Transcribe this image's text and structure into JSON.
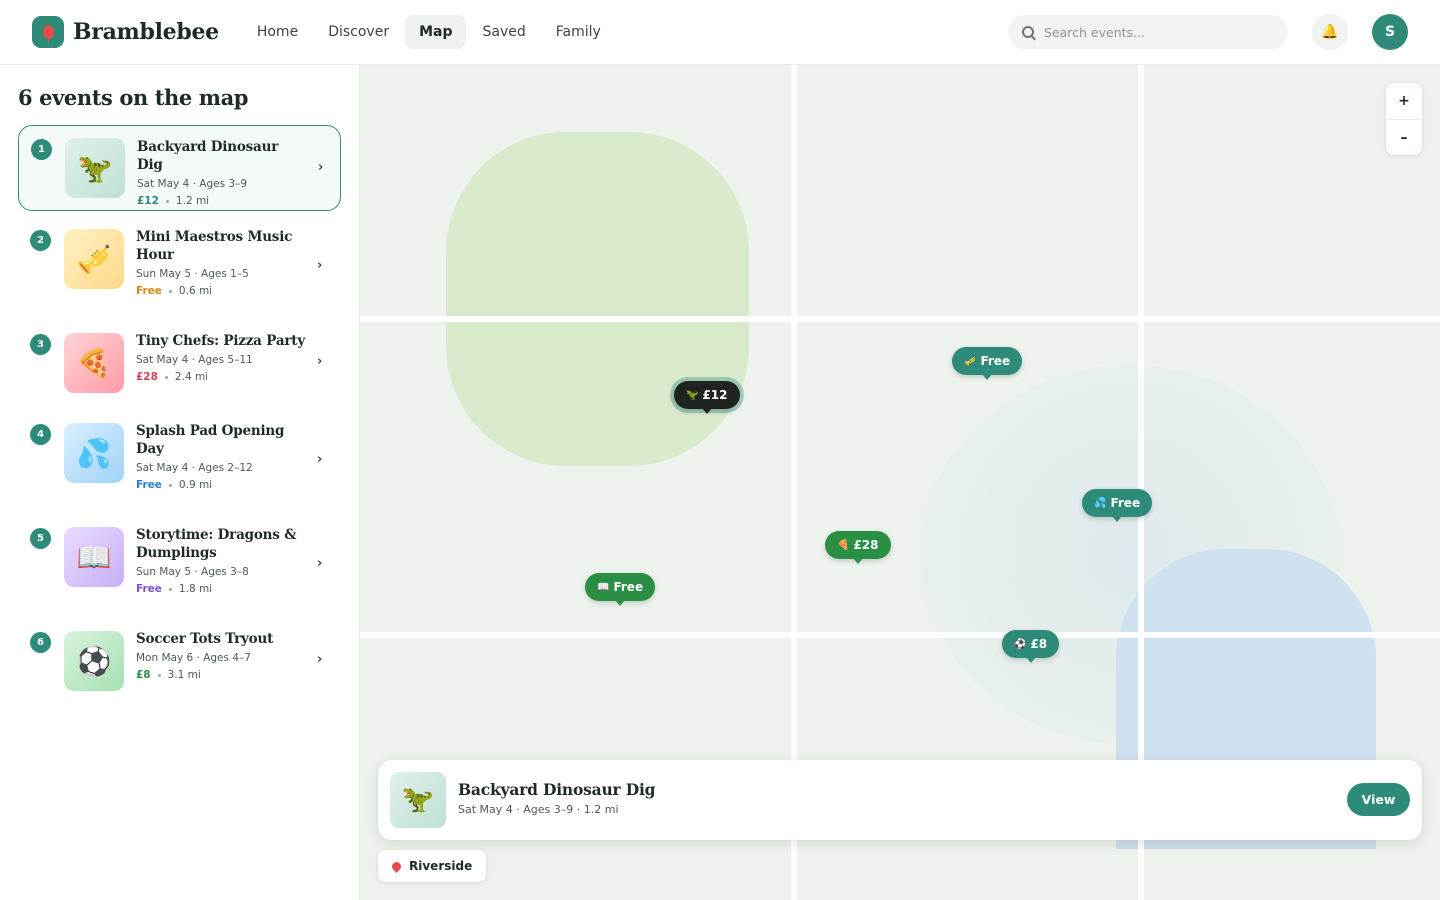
{
  "app": {
    "name": "Bramblebee"
  },
  "nav": {
    "items": [
      {
        "label": "Home"
      },
      {
        "label": "Discover"
      },
      {
        "label": "Map"
      },
      {
        "label": "Saved"
      },
      {
        "label": "Family"
      }
    ],
    "active": "Map"
  },
  "search": {
    "placeholder": "Search events..."
  },
  "user": {
    "initial": "S"
  },
  "sidebar": {
    "title": "6 events on the map",
    "events": [
      {
        "num": "1",
        "title": "Backyard Dinosaur Dig",
        "meta": "Sat May 4 · Ages 3–9",
        "price": "£12",
        "price_color": "#2e8b7a",
        "distance": "1.2 mi",
        "icon": "dinosaur",
        "glyph": "🦖",
        "thumb_bg": "linear-gradient(135deg,#dff0ea,#bfe0d6)"
      },
      {
        "num": "2",
        "title": "Mini Maestros Music Hour",
        "meta": "Sun May 5 · Ages 1–5",
        "price": "Free",
        "price_color": "#d68a10",
        "distance": "0.6 mi",
        "icon": "trumpet",
        "glyph": "🎺",
        "thumb_bg": "linear-gradient(135deg,#fff1c2,#ffd88a)"
      },
      {
        "num": "3",
        "title": "Tiny Chefs: Pizza Party",
        "meta": "Sat May 4 · Ages 5–11",
        "price": "£28",
        "price_color": "#d0455a",
        "distance": "2.4 mi",
        "icon": "pizza",
        "glyph": "🍕",
        "thumb_bg": "linear-gradient(135deg,#ffd4d8,#ff9aa6)"
      },
      {
        "num": "4",
        "title": "Splash Pad Opening Day",
        "meta": "Sat May 4 · Ages 2–12",
        "price": "Free",
        "price_color": "#2f7fd0",
        "distance": "0.9 mi",
        "icon": "droplets",
        "glyph": "💦",
        "thumb_bg": "linear-gradient(135deg,#d9efff,#9fd3f7)"
      },
      {
        "num": "5",
        "title": "Storytime: Dragons & Dumplings",
        "meta": "Sun May 5 · Ages 3–8",
        "price": "Free",
        "price_color": "#7a4fd0",
        "distance": "1.8 mi",
        "icon": "open-book",
        "glyph": "📖",
        "thumb_bg": "linear-gradient(135deg,#e9dcff,#c6aef5)"
      },
      {
        "num": "6",
        "title": "Soccer Tots Tryout",
        "meta": "Mon May 6 · Ages 4–7",
        "price": "£8",
        "price_color": "#2a8f45",
        "distance": "3.1 mi",
        "icon": "soccer-ball",
        "glyph": "⚽",
        "thumb_bg": "linear-gradient(135deg,#d8f3dd,#a6e0b2)"
      }
    ]
  },
  "map": {
    "pins": [
      {
        "label": "£12",
        "glyph": "🦖",
        "style": "dark"
      },
      {
        "label": "Free",
        "glyph": "🎺",
        "style": "teal"
      },
      {
        "label": "Free",
        "glyph": "💦",
        "style": "teal"
      },
      {
        "label": "£28",
        "glyph": "🍕",
        "style": "green"
      },
      {
        "label": "Free",
        "glyph": "📖",
        "style": "green"
      },
      {
        "label": "£8",
        "glyph": "⚽",
        "style": "teal"
      }
    ],
    "zoom_in": "+",
    "zoom_out": "–",
    "area": "Riverside"
  },
  "card": {
    "title": "Backyard Dinosaur Dig",
    "meta": "Sat May 4 · Ages 3–9 · 1.2 mi",
    "glyph": "🦖",
    "view_label": "View"
  },
  "colors": {
    "accent": "#2e8b7a",
    "park": "#d9e9cc",
    "water": "#cfe0ee"
  }
}
